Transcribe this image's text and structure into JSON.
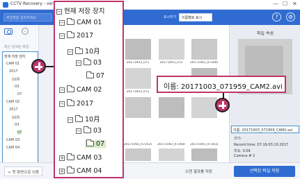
{
  "window": {
    "title": "CCTV Recovery - version 1",
    "controls": [
      "—",
      "☐",
      "✕"
    ]
  },
  "toolbar": {
    "search_placeholder": "파일명을 입력하세요",
    "display_label": "표시하기",
    "display_select": "이름별로 표시",
    "help_icon": "?",
    "settings_icon": "⚙"
  },
  "sidebar": {
    "recent_label": "최근 검색된 파일",
    "mini_tree": [
      "현재 저장 장치",
      "CAM 01",
      "2017",
      "10月",
      "03",
      "07",
      "CAM 02",
      "2017",
      "10月",
      "03",
      "07",
      "CAM 03",
      "CAM 04"
    ]
  },
  "tree_zoom": {
    "root": "현재 저장 장치",
    "items": [
      {
        "label": "CAM 01",
        "toggle": "−",
        "selected": false
      },
      {
        "label": "2017",
        "toggle": "−",
        "selected": false
      },
      {
        "label": "10月",
        "toggle": "−",
        "selected": false
      },
      {
        "label": "03",
        "toggle": "−",
        "selected": false
      },
      {
        "label": "07",
        "toggle": "",
        "selected": false
      },
      {
        "label": "CAM 02",
        "toggle": "−",
        "selected": false
      },
      {
        "label": "2017",
        "toggle": "−",
        "selected": false
      },
      {
        "label": "10月",
        "toggle": "−",
        "selected": false
      },
      {
        "label": "03",
        "toggle": "−",
        "selected": false
      },
      {
        "label": "07",
        "toggle": "",
        "selected": true
      },
      {
        "label": "CAM 03",
        "toggle": "+",
        "selected": false
      },
      {
        "label": "CAM 04",
        "toggle": "+",
        "selected": false
      }
    ]
  },
  "grid": {
    "captions": [
      "20171003_071",
      "20171003_072",
      "20171003_071800_CAM2",
      "20171003_072",
      "20171003_073",
      "20171003_072539_CAM2",
      "20171003_072644_CAM2",
      "20171003_073018_CAM2",
      "20171003_073"
    ]
  },
  "info_panel": {
    "heading": "파일 속성",
    "name_row": "이름: 20171003_071959_CAM2.avi",
    "size_row": "크기:",
    "record_time": "Record time: 07:19.03.10.2017",
    "duration": "지속: 3:09",
    "camera": "Camera # 2"
  },
  "name_zoom": {
    "text": "이름: 20171003_071959_CAM2.avi"
  },
  "bottombar": {
    "back_button": "< 첫 화면으로 이동",
    "save_button": "스캔 결과를 저장",
    "recover_button": "선택된 파일 저장"
  },
  "colors": {
    "accent": "#2f6bd1",
    "highlight_frame": "#c0326a",
    "selection": "#d6ecc7",
    "mini_tree_frame": "#4a90c8"
  }
}
